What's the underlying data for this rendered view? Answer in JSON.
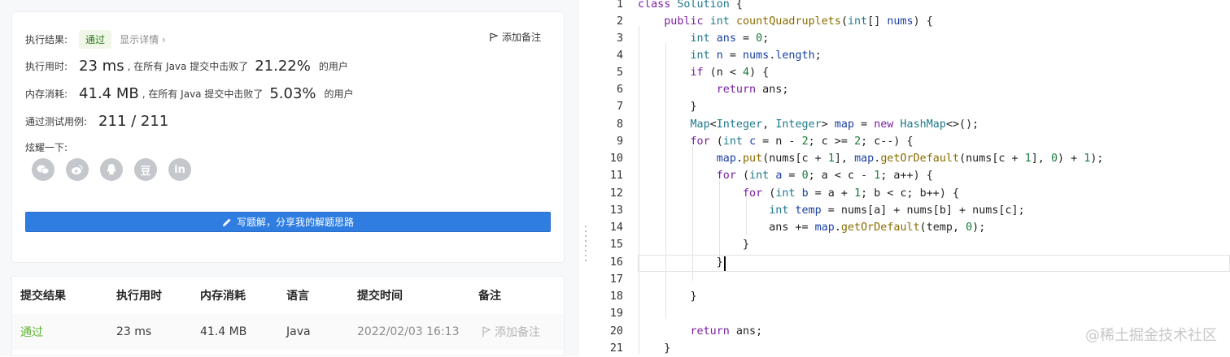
{
  "result": {
    "label": "执行结果:",
    "status": "通过",
    "detail": "显示详情 ›",
    "add_note": "添加备注"
  },
  "time": {
    "label": "执行用时:",
    "value": "23 ms",
    "mid": ", 在所有 Java 提交中击败了",
    "percent": "21.22%",
    "suffix": "的用户"
  },
  "memory": {
    "label": "内存消耗:",
    "value": "41.4 MB",
    "mid": ", 在所有 Java 提交中击败了",
    "percent": "5.03%",
    "suffix": "的用户"
  },
  "tests": {
    "label": "通过测试用例:",
    "value": "211 / 211"
  },
  "share": {
    "label": "炫耀一下:",
    "icons": [
      "wechat-icon",
      "weibo-icon",
      "qq-icon",
      "douban-icon",
      "linkedin-icon"
    ],
    "douban_glyph": "豆",
    "linkedin_glyph": "in"
  },
  "write_button": "写题解，分享我的解题思路",
  "table": {
    "headers": [
      "提交结果",
      "执行用时",
      "内存消耗",
      "语言",
      "提交时间",
      "备注"
    ],
    "row": {
      "status": "通过",
      "time": "23 ms",
      "memory": "41.4 MB",
      "lang": "Java",
      "submitted": "2022/02/03 16:13",
      "note": "添加备注"
    }
  },
  "code": {
    "line_numbers": [
      "1",
      "2",
      "3",
      "4",
      "5",
      "6",
      "7",
      "8",
      "9",
      "10",
      "11",
      "12",
      "13",
      "14",
      "15",
      "16",
      "17",
      "18",
      "19",
      "20",
      "21"
    ]
  },
  "watermark": "@稀土掘金技术社区",
  "colors": {
    "accent": "#2f7de1",
    "pass": "#2a7a1c"
  }
}
